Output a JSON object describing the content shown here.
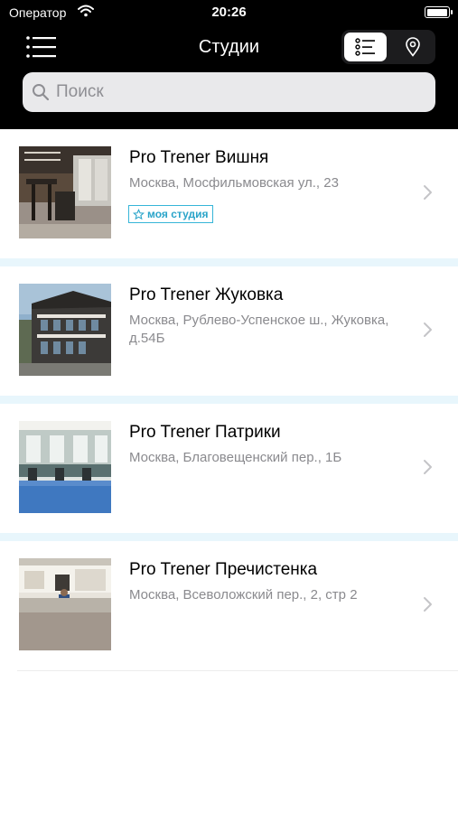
{
  "status_bar": {
    "carrier": "Оператор",
    "time": "20:26"
  },
  "nav": {
    "title": "Студии",
    "view_mode": "list"
  },
  "search": {
    "placeholder": "Поиск",
    "value": ""
  },
  "studios": [
    {
      "name": "Pro Trener Вишня",
      "address": "Москва, Мосфильмовская ул., 23",
      "badge": "моя студия"
    },
    {
      "name": "Pro Trener Жуковка",
      "address": "Москва, Рублево-Успенское ш., Жуковка, д.54Б"
    },
    {
      "name": "Pro Trener Патрики",
      "address": "Москва, Благовещенский пер., 1Б"
    },
    {
      "name": "Pro Trener Пречистенка",
      "address": "Москва, Всеволожский пер., 2, стр 2"
    }
  ],
  "colors": {
    "accent": "#2aa4c9",
    "separator": "#e8f6fc",
    "header": "#000000"
  }
}
